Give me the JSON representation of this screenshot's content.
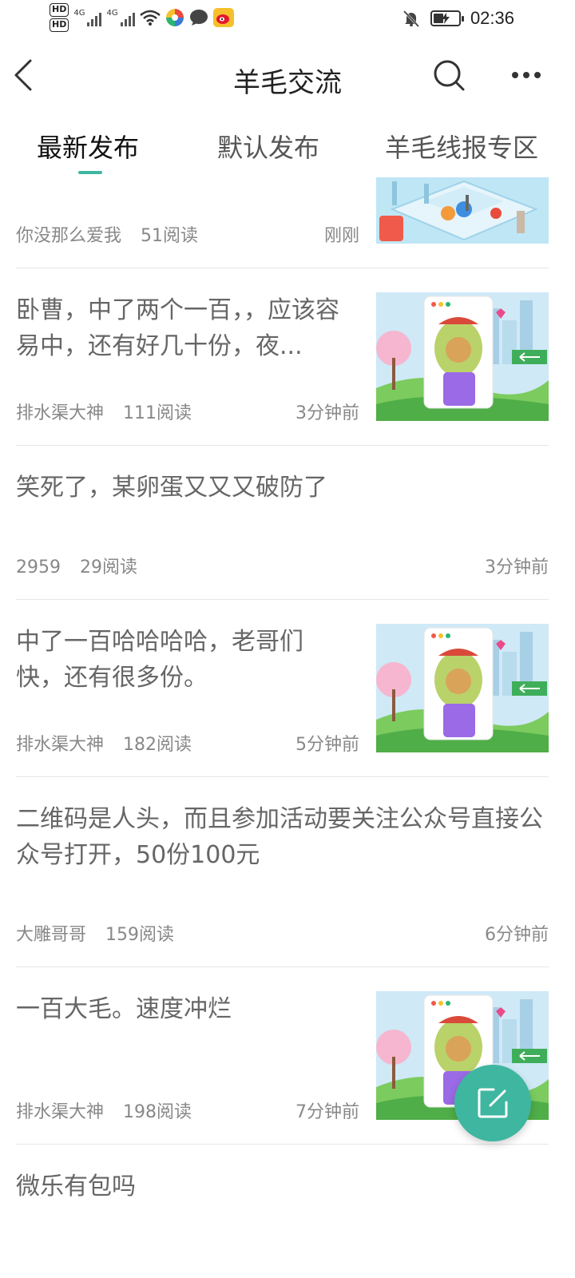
{
  "status_bar": {
    "hd1": "HD",
    "hd2": "HD",
    "net1": "4G",
    "net2": "4G",
    "time": "02:36"
  },
  "nav": {
    "title": "羊毛交流",
    "back_icon": "chevron-left-icon",
    "search_icon": "search-icon",
    "more_icon": "more-horizontal-icon"
  },
  "tabs": [
    {
      "label": "最新发布",
      "active": true
    },
    {
      "label": "默认发布",
      "active": false
    },
    {
      "label": "羊毛线报专区",
      "active": false
    }
  ],
  "posts": [
    {
      "title": "",
      "author": "你没那么爱我",
      "reads": "51阅读",
      "time": "刚刚",
      "has_image": true
    },
    {
      "title": "卧曹，中了两个一百，，应该容易中，还有好几十份，夜...",
      "author": "排水渠大神",
      "reads": "111阅读",
      "time": "3分钟前",
      "has_image": true
    },
    {
      "title": "笑死了，某卵蛋又又又破防了",
      "author": "2959",
      "reads": "29阅读",
      "time": "3分钟前",
      "has_image": false
    },
    {
      "title": "中了一百哈哈哈哈，老哥们快，还有很多份。",
      "author": "排水渠大神",
      "reads": "182阅读",
      "time": "5分钟前",
      "has_image": true
    },
    {
      "title": "二维码是人头，而且参加活动要关注公众号直接公众号打开，50份100元",
      "author": "大雕哥哥",
      "reads": "159阅读",
      "time": "6分钟前",
      "has_image": false
    },
    {
      "title": "一百大毛。速度冲烂",
      "author": "排水渠大神",
      "reads": "198阅读",
      "time": "7分钟前",
      "has_image": true
    },
    {
      "title": "微乐有包吗",
      "author": "",
      "reads": "",
      "time": "",
      "has_image": false
    }
  ],
  "fab": {
    "icon": "edit-icon"
  },
  "colors": {
    "accent": "#3fb6a0",
    "divider": "#e6e6e6",
    "meta_text": "#888888"
  }
}
